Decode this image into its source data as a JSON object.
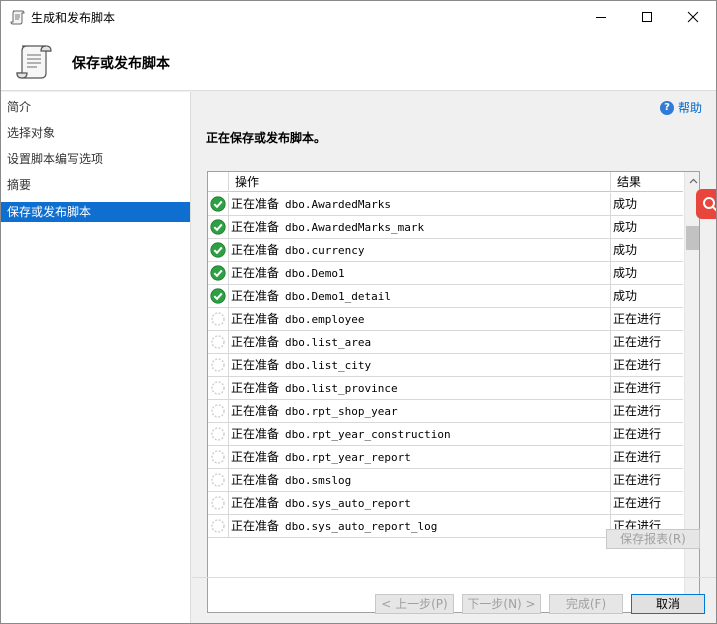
{
  "window": {
    "title": "生成和发布脚本",
    "controls": {
      "minimize": "minimize-icon",
      "maximize": "maximize-icon",
      "close": "close-icon"
    }
  },
  "header": {
    "title": "保存或发布脚本"
  },
  "nav": {
    "items": [
      {
        "label": "简介",
        "active": false
      },
      {
        "label": "选择对象",
        "active": false
      },
      {
        "label": "设置脚本编写选项",
        "active": false
      },
      {
        "label": "摘要",
        "active": false
      },
      {
        "label": "保存或发布脚本",
        "active": true
      }
    ]
  },
  "content": {
    "help_label": "帮助",
    "section_title": "正在保存或发布脚本。",
    "grid": {
      "columns": {
        "operation": "操作",
        "result": "结果"
      },
      "rows": [
        {
          "status": "success",
          "action": "正在准备",
          "object": "dbo.AwardedMarks",
          "result": "成功"
        },
        {
          "status": "success",
          "action": "正在准备",
          "object": "dbo.AwardedMarks_mark",
          "result": "成功"
        },
        {
          "status": "success",
          "action": "正在准备",
          "object": "dbo.currency",
          "result": "成功"
        },
        {
          "status": "success",
          "action": "正在准备",
          "object": "dbo.Demo1",
          "result": "成功"
        },
        {
          "status": "success",
          "action": "正在准备",
          "object": "dbo.Demo1_detail",
          "result": "成功"
        },
        {
          "status": "progress",
          "action": "正在准备",
          "object": "dbo.employee",
          "result": "正在进行"
        },
        {
          "status": "progress",
          "action": "正在准备",
          "object": "dbo.list_area",
          "result": "正在进行"
        },
        {
          "status": "progress",
          "action": "正在准备",
          "object": "dbo.list_city",
          "result": "正在进行"
        },
        {
          "status": "progress",
          "action": "正在准备",
          "object": "dbo.list_province",
          "result": "正在进行"
        },
        {
          "status": "progress",
          "action": "正在准备",
          "object": "dbo.rpt_shop_year",
          "result": "正在进行"
        },
        {
          "status": "progress",
          "action": "正在准备",
          "object": "dbo.rpt_year_construction",
          "result": "正在进行"
        },
        {
          "status": "progress",
          "action": "正在准备",
          "object": "dbo.rpt_year_report",
          "result": "正在进行"
        },
        {
          "status": "progress",
          "action": "正在准备",
          "object": "dbo.smslog",
          "result": "正在进行"
        },
        {
          "status": "progress",
          "action": "正在准备",
          "object": "dbo.sys_auto_report",
          "result": "正在进行"
        },
        {
          "status": "progress",
          "action": "正在准备",
          "object": "dbo.sys_auto_report_log",
          "result": "正在进行"
        }
      ]
    },
    "save_report_button": "保存报表(R)"
  },
  "footer": {
    "prev": "< 上一步(P)",
    "next": "下一步(N) >",
    "finish": "完成(F)",
    "cancel": "取消"
  },
  "colors": {
    "nav_active": "#0f6fd1",
    "success": "#2ea043",
    "help_link": "#0066cc",
    "side_tab": "#e8453c"
  }
}
